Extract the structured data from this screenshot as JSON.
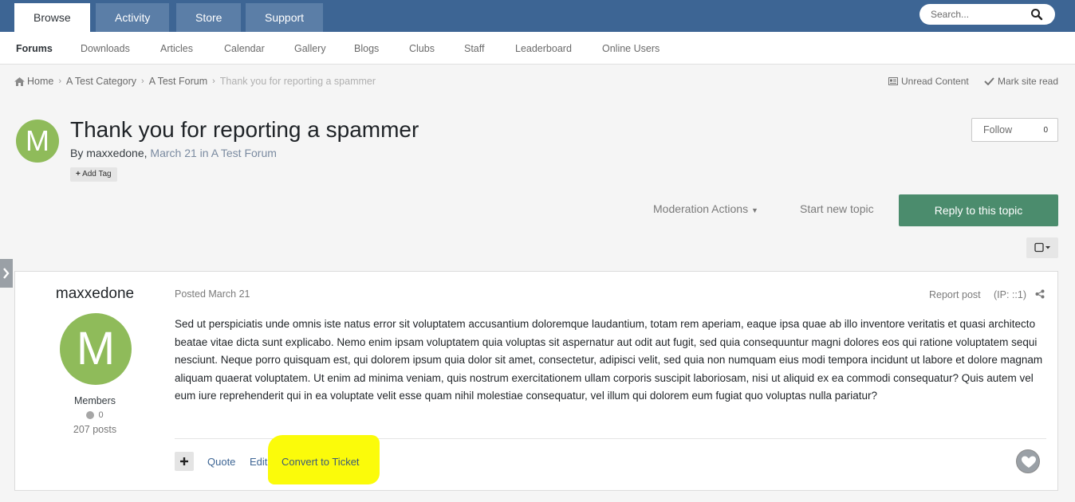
{
  "topnav": {
    "tabs": [
      {
        "label": "Browse"
      },
      {
        "label": "Activity"
      },
      {
        "label": "Store"
      },
      {
        "label": "Support"
      }
    ],
    "search_placeholder": "Search..."
  },
  "subnav": {
    "items": [
      {
        "label": "Forums"
      },
      {
        "label": "Downloads"
      },
      {
        "label": "Articles"
      },
      {
        "label": "Calendar"
      },
      {
        "label": "Gallery"
      },
      {
        "label": "Blogs"
      },
      {
        "label": "Clubs"
      },
      {
        "label": "Staff"
      },
      {
        "label": "Leaderboard"
      },
      {
        "label": "Online Users"
      }
    ]
  },
  "breadcrumb": {
    "home": "Home",
    "category": "A Test Category",
    "forum": "A Test Forum",
    "current": "Thank you for reporting a spammer"
  },
  "links": {
    "unread": "Unread Content",
    "mark_read": "Mark site read"
  },
  "topic": {
    "avatar_letter": "M",
    "title": "Thank you for reporting a spammer",
    "by": "By",
    "author": "maxxedone,",
    "date": "March 21",
    "in": "in",
    "forum": "A Test Forum",
    "add_tag": "Add Tag",
    "follow_label": "Follow",
    "follow_count": "0"
  },
  "actions": {
    "moderation": "Moderation Actions",
    "start_new": "Start new topic",
    "reply": "Reply to this topic"
  },
  "post": {
    "author": "maxxedone",
    "avatar_letter": "M",
    "group": "Members",
    "reputation": "0",
    "posts": "207 posts",
    "posted": "Posted March 21",
    "report": "Report post",
    "ip": "(IP: ::1)",
    "body": "Sed ut perspiciatis unde omnis iste natus error sit voluptatem accusantium doloremque laudantium, totam rem aperiam, eaque ipsa quae ab illo inventore veritatis et quasi architecto beatae vitae dicta sunt explicabo. Nemo enim ipsam voluptatem quia voluptas sit aspernatur aut odit aut fugit, sed quia consequuntur magni dolores eos qui ratione voluptatem sequi nesciunt. Neque porro quisquam est, qui dolorem ipsum quia dolor sit amet, consectetur, adipisci velit, sed quia non numquam eius modi tempora incidunt ut labore et dolore magnam aliquam quaerat voluptatem. Ut enim ad minima veniam, quis nostrum exercitationem ullam corporis suscipit laboriosam, nisi ut aliquid ex ea commodi consequatur? Quis autem vel eum iure reprehenderit qui in ea voluptate velit esse quam nihil molestiae consequatur, vel illum qui dolorem eum fugiat quo voluptas nulla pariatur?",
    "quote": "Quote",
    "edit": "Edit",
    "convert": "Convert to Ticket"
  },
  "colors": {
    "header_bg": "#3d6594",
    "reply_button": "#4b8c6d",
    "avatar": "#8fbb5a",
    "highlight": "#fbfb0a"
  }
}
